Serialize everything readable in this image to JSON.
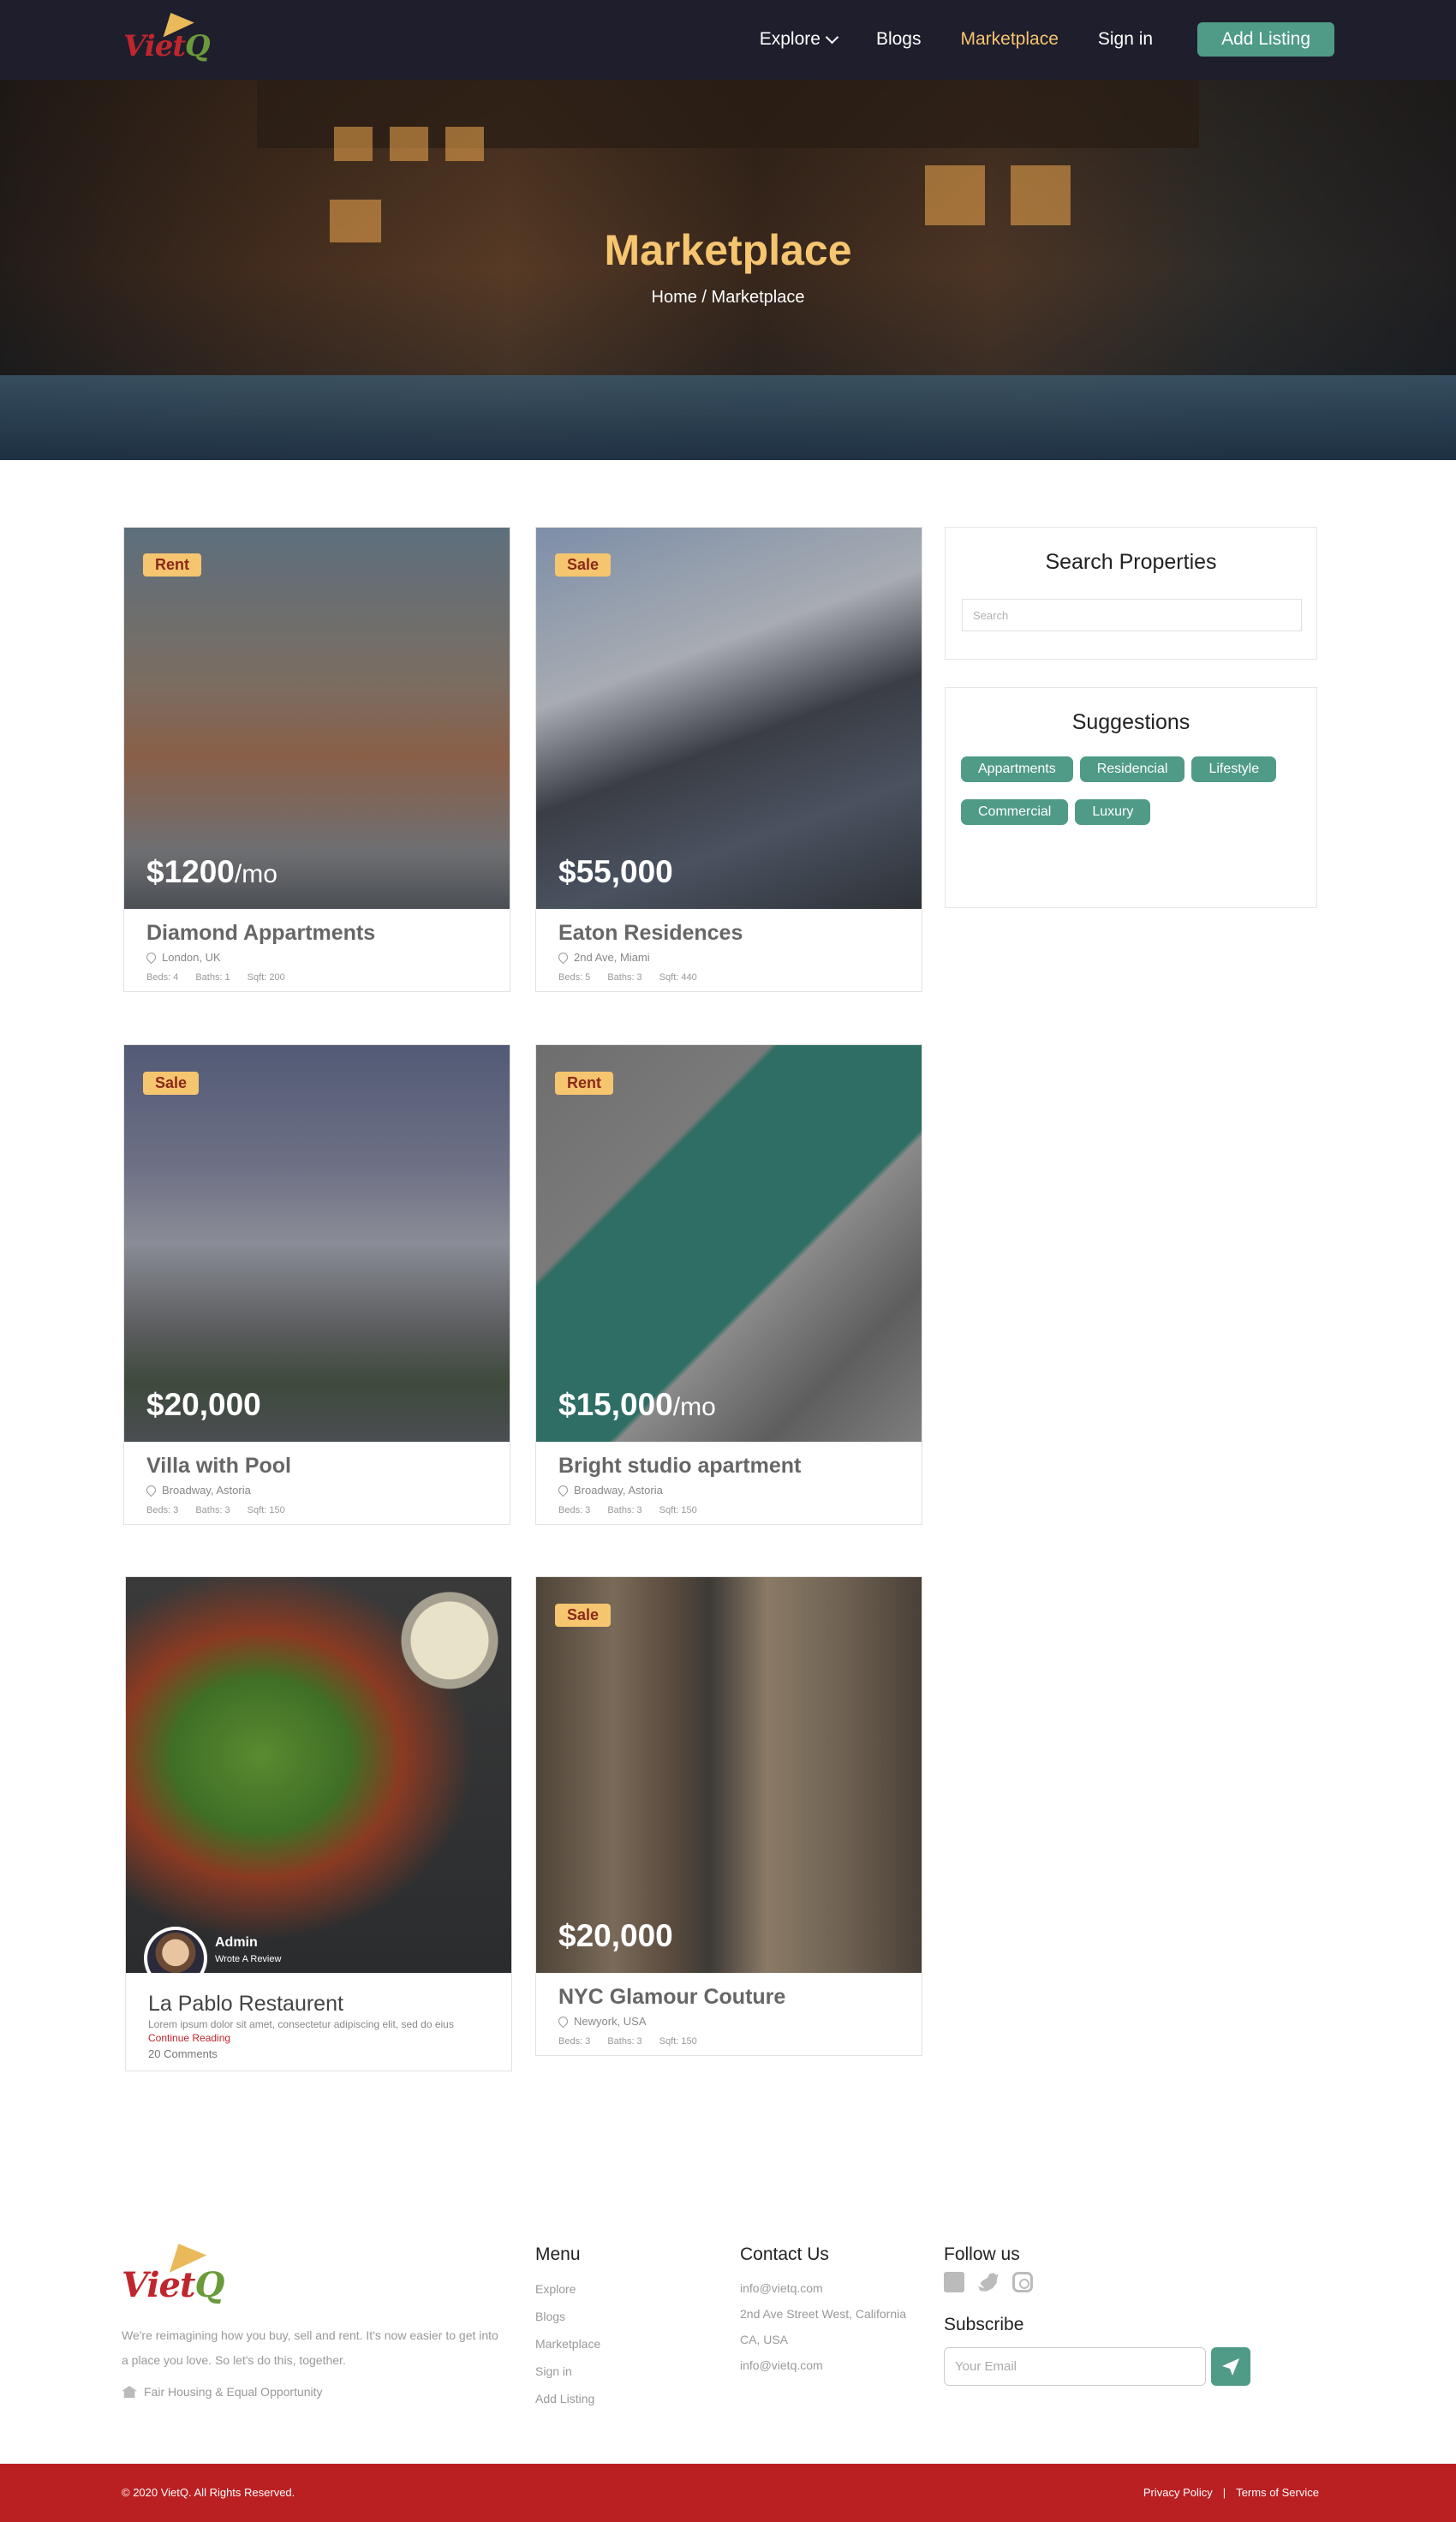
{
  "nav": {
    "logo": "VietQ",
    "links": [
      "Explore",
      "Blogs",
      "Marketplace",
      "Sign in"
    ],
    "active": "Marketplace",
    "add_listing": "Add Listing"
  },
  "hero": {
    "title": "Marketplace",
    "breadcrumb": "Home / Marketplace"
  },
  "listings": [
    {
      "badge": "Rent",
      "price": "$1200",
      "unit": "/mo",
      "title": "Diamond Appartments",
      "location": "London, UK",
      "beds": "Beds: 4",
      "baths": "Baths: 1",
      "sqft": "Sqft: 200"
    },
    {
      "badge": "Sale",
      "price": "$55,000",
      "unit": "",
      "title": "Eaton Residences",
      "location": "2nd Ave, Miami",
      "beds": "Beds: 5",
      "baths": "Baths: 3",
      "sqft": "Sqft: 440"
    },
    {
      "badge": "Sale",
      "price": "$20,000",
      "unit": "",
      "title": "Villa with Pool",
      "location": "Broadway, Astoria",
      "beds": "Beds: 3",
      "baths": "Baths: 3",
      "sqft": "Sqft: 150"
    },
    {
      "badge": "Rent",
      "price": "$15,000",
      "unit": "/mo",
      "title": "Bright studio apartment",
      "location": "Broadway, Astoria",
      "beds": "Beds: 3",
      "baths": "Baths: 3",
      "sqft": "Sqft: 150"
    },
    {
      "badge": "Sale",
      "price": "$20,000",
      "unit": "",
      "title": "NYC Glamour Couture",
      "location": "Newyork, USA",
      "beds": "Beds: 3",
      "baths": "Baths: 3",
      "sqft": "Sqft: 150"
    }
  ],
  "blog": {
    "author": "Admin",
    "author_sub": "Wrote A Review",
    "title": "La Pablo Restaurent",
    "excerpt": "Lorem ipsum dolor sit amet, consectetur adipiscing elit, sed do eius",
    "more": "Continue Reading",
    "comments": "20 Comments"
  },
  "sidebar": {
    "search_title": "Search Properties",
    "search_placeholder": "Search",
    "suggest_title": "Suggestions",
    "tags": [
      "Appartments",
      "Residencial",
      "Lifestyle",
      "Commercial",
      "Luxury"
    ]
  },
  "footer": {
    "desc": "We're reimagining how you buy, sell and rent. It's now easier to get into a place you love. So let's do this, together.",
    "fair": "Fair Housing & Equal Opportunity",
    "menu_title": "Menu",
    "menu": [
      "Explore",
      "Blogs",
      "Marketplace",
      "Sign in",
      "Add Listing"
    ],
    "contact_title": "Contact Us",
    "email": "info@vietq.com",
    "address": "2nd Ave Street West, California CA, USA",
    "email2": "info@vietq.com",
    "follow_title": "Follow us",
    "social": [
      "facebook-icon",
      "twitter-icon",
      "instagram-icon"
    ],
    "subscribe_title": "Subscribe",
    "email_placeholder": "Your Email",
    "copyright": "© 2020 VietQ. All Rights Reserved.",
    "privacy": "Privacy Policy",
    "terms": "Terms of Service"
  },
  "colors": {
    "nav_bg": "#1f1e2d",
    "accent": "#4f9b87",
    "gold": "#f6c56f",
    "footer_bar": "#ba1f22"
  }
}
